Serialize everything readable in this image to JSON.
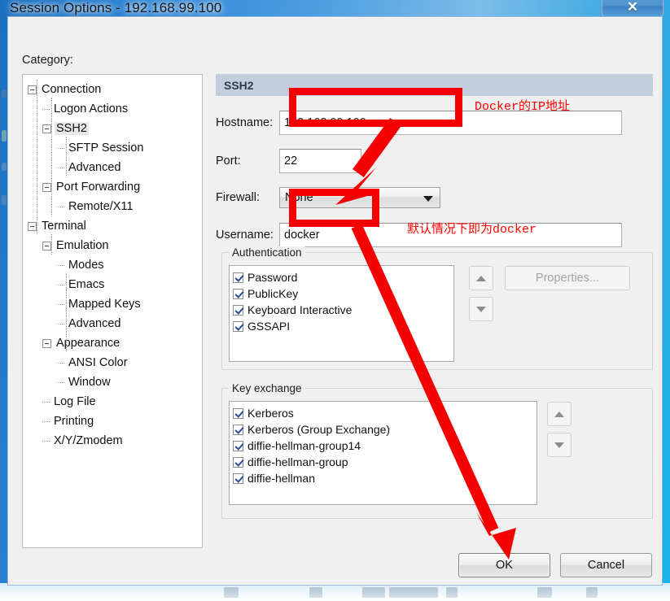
{
  "window": {
    "title": "Session Options - 192.168.99.100",
    "close_label": "✕",
    "category_label": "Category:"
  },
  "tree": {
    "items": [
      {
        "label": "Connection",
        "depth": 0,
        "expander": true,
        "selected": false
      },
      {
        "label": "Logon Actions",
        "depth": 1,
        "expander": false,
        "selected": false
      },
      {
        "label": "SSH2",
        "depth": 1,
        "expander": true,
        "selected": true
      },
      {
        "label": "SFTP Session",
        "depth": 2,
        "expander": false,
        "selected": false
      },
      {
        "label": "Advanced",
        "depth": 2,
        "expander": false,
        "selected": false
      },
      {
        "label": "Port Forwarding",
        "depth": 1,
        "expander": true,
        "selected": false
      },
      {
        "label": "Remote/X11",
        "depth": 2,
        "expander": false,
        "selected": false
      },
      {
        "label": "Terminal",
        "depth": 0,
        "expander": true,
        "selected": false
      },
      {
        "label": "Emulation",
        "depth": 1,
        "expander": true,
        "selected": false
      },
      {
        "label": "Modes",
        "depth": 2,
        "expander": false,
        "selected": false
      },
      {
        "label": "Emacs",
        "depth": 2,
        "expander": false,
        "selected": false
      },
      {
        "label": "Mapped Keys",
        "depth": 2,
        "expander": false,
        "selected": false
      },
      {
        "label": "Advanced",
        "depth": 2,
        "expander": false,
        "selected": false
      },
      {
        "label": "Appearance",
        "depth": 1,
        "expander": true,
        "selected": false
      },
      {
        "label": "ANSI Color",
        "depth": 2,
        "expander": false,
        "selected": false
      },
      {
        "label": "Window",
        "depth": 2,
        "expander": false,
        "selected": false
      },
      {
        "label": "Log File",
        "depth": 1,
        "expander": false,
        "selected": false
      },
      {
        "label": "Printing",
        "depth": 1,
        "expander": false,
        "selected": false
      },
      {
        "label": "X/Y/Zmodem",
        "depth": 1,
        "expander": false,
        "selected": false
      }
    ]
  },
  "panel": {
    "header": "SSH2",
    "fields": {
      "hostname_label": "Hostname:",
      "hostname_value": "192.168.99.100",
      "port_label": "Port:",
      "port_value": "22",
      "firewall_label": "Firewall:",
      "firewall_value": "None",
      "username_label": "Username:",
      "username_value": "docker"
    },
    "authentication": {
      "title": "Authentication",
      "items": [
        {
          "label": "Password",
          "checked": true
        },
        {
          "label": "PublicKey",
          "checked": true
        },
        {
          "label": "Keyboard Interactive",
          "checked": true
        },
        {
          "label": "GSSAPI",
          "checked": true
        }
      ],
      "properties_label": "Properties..."
    },
    "key_exchange": {
      "title": "Key exchange",
      "items": [
        {
          "label": "Kerberos",
          "checked": true
        },
        {
          "label": "Kerberos (Group Exchange)",
          "checked": true
        },
        {
          "label": "diffie-hellman-group14",
          "checked": true
        },
        {
          "label": "diffie-hellman-group",
          "checked": true
        },
        {
          "label": "diffie-hellman",
          "checked": true
        }
      ]
    }
  },
  "buttons": {
    "ok": "OK",
    "cancel": "Cancel"
  },
  "annotations": {
    "color": "#ff0000",
    "hostname_note": "Docker的IP地址",
    "username_note": "默认情况下即为docker"
  }
}
